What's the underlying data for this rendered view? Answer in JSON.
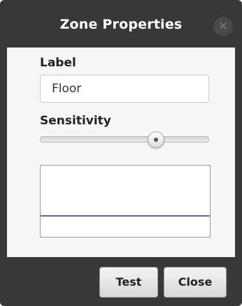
{
  "dialog": {
    "title": "Zone Properties",
    "close_icon": "close-x-icon",
    "close_glyph": "×"
  },
  "form": {
    "label_heading": "Label",
    "label_value": "Floor",
    "sensitivity_heading": "Sensitivity",
    "sensitivity_level": 0.68
  },
  "graph": {
    "line_color": "#6b5fc7"
  },
  "footer": {
    "test_label": "Test",
    "close_label": "Close"
  }
}
